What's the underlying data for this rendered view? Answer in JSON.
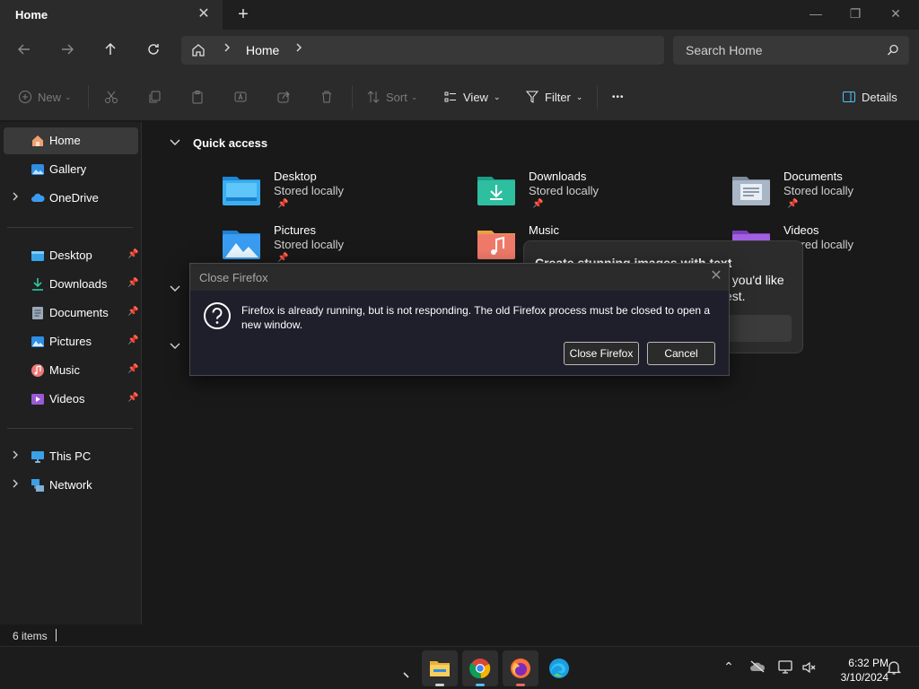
{
  "window": {
    "tab_title": "Home",
    "tab_close_glyph": "✕",
    "new_tab_glyph": "+",
    "minimize_glyph": "—",
    "maximize_glyph": "❐",
    "close_glyph": "✕"
  },
  "address_bar": {
    "location": "Home",
    "search_placeholder": "Search Home"
  },
  "command_bar": {
    "new_label": "New",
    "sort_label": "Sort",
    "view_label": "View",
    "filter_label": "Filter",
    "more_glyph": "•••",
    "details_label": "Details"
  },
  "sidebar": {
    "top": [
      {
        "label": "Home",
        "icon": "home-icon",
        "selected": true
      },
      {
        "label": "Gallery",
        "icon": "gallery-icon"
      },
      {
        "label": "OneDrive",
        "icon": "onedrive-icon",
        "expandable": true
      }
    ],
    "pinned": [
      {
        "label": "Desktop",
        "icon": "desktop-folder-icon"
      },
      {
        "label": "Downloads",
        "icon": "downloads-folder-icon"
      },
      {
        "label": "Documents",
        "icon": "documents-folder-icon"
      },
      {
        "label": "Pictures",
        "icon": "pictures-folder-icon"
      },
      {
        "label": "Music",
        "icon": "music-folder-icon"
      },
      {
        "label": "Videos",
        "icon": "videos-folder-icon"
      }
    ],
    "bottom": [
      {
        "label": "This PC",
        "icon": "this-pc-icon"
      },
      {
        "label": "Network",
        "icon": "network-icon"
      }
    ]
  },
  "quick_access": {
    "title": "Quick access",
    "items": [
      {
        "name": "Desktop",
        "sub": "Stored locally"
      },
      {
        "name": "Downloads",
        "sub": "Stored locally"
      },
      {
        "name": "Documents",
        "sub": "Stored locally"
      },
      {
        "name": "Pictures",
        "sub": "Stored locally"
      },
      {
        "name": "Music",
        "sub": ""
      },
      {
        "name": "Videos",
        "sub": "Stored locally"
      }
    ]
  },
  "popup": {
    "title": "Create stunning images with text",
    "text": "t you'd like est."
  },
  "dialog": {
    "title": "Close Firefox",
    "message": "Firefox is already running, but is not responding. The old Firefox process must be closed to open a new window.",
    "primary_button": "Close Firefox",
    "cancel_button": "Cancel",
    "close_glyph": "✕"
  },
  "status_bar": {
    "item_count": "6 items"
  },
  "taskbar": {
    "time": "6:32 PM",
    "date": "3/10/2024",
    "tray_chevron_glyph": "⌃"
  },
  "colors": {
    "accent": "#4cc2ff",
    "folder_blue": "#3aa0f0",
    "downloads_green": "#2fb8a0",
    "music_orange": "#f07a5a",
    "videos_purple": "#9b59d6"
  }
}
